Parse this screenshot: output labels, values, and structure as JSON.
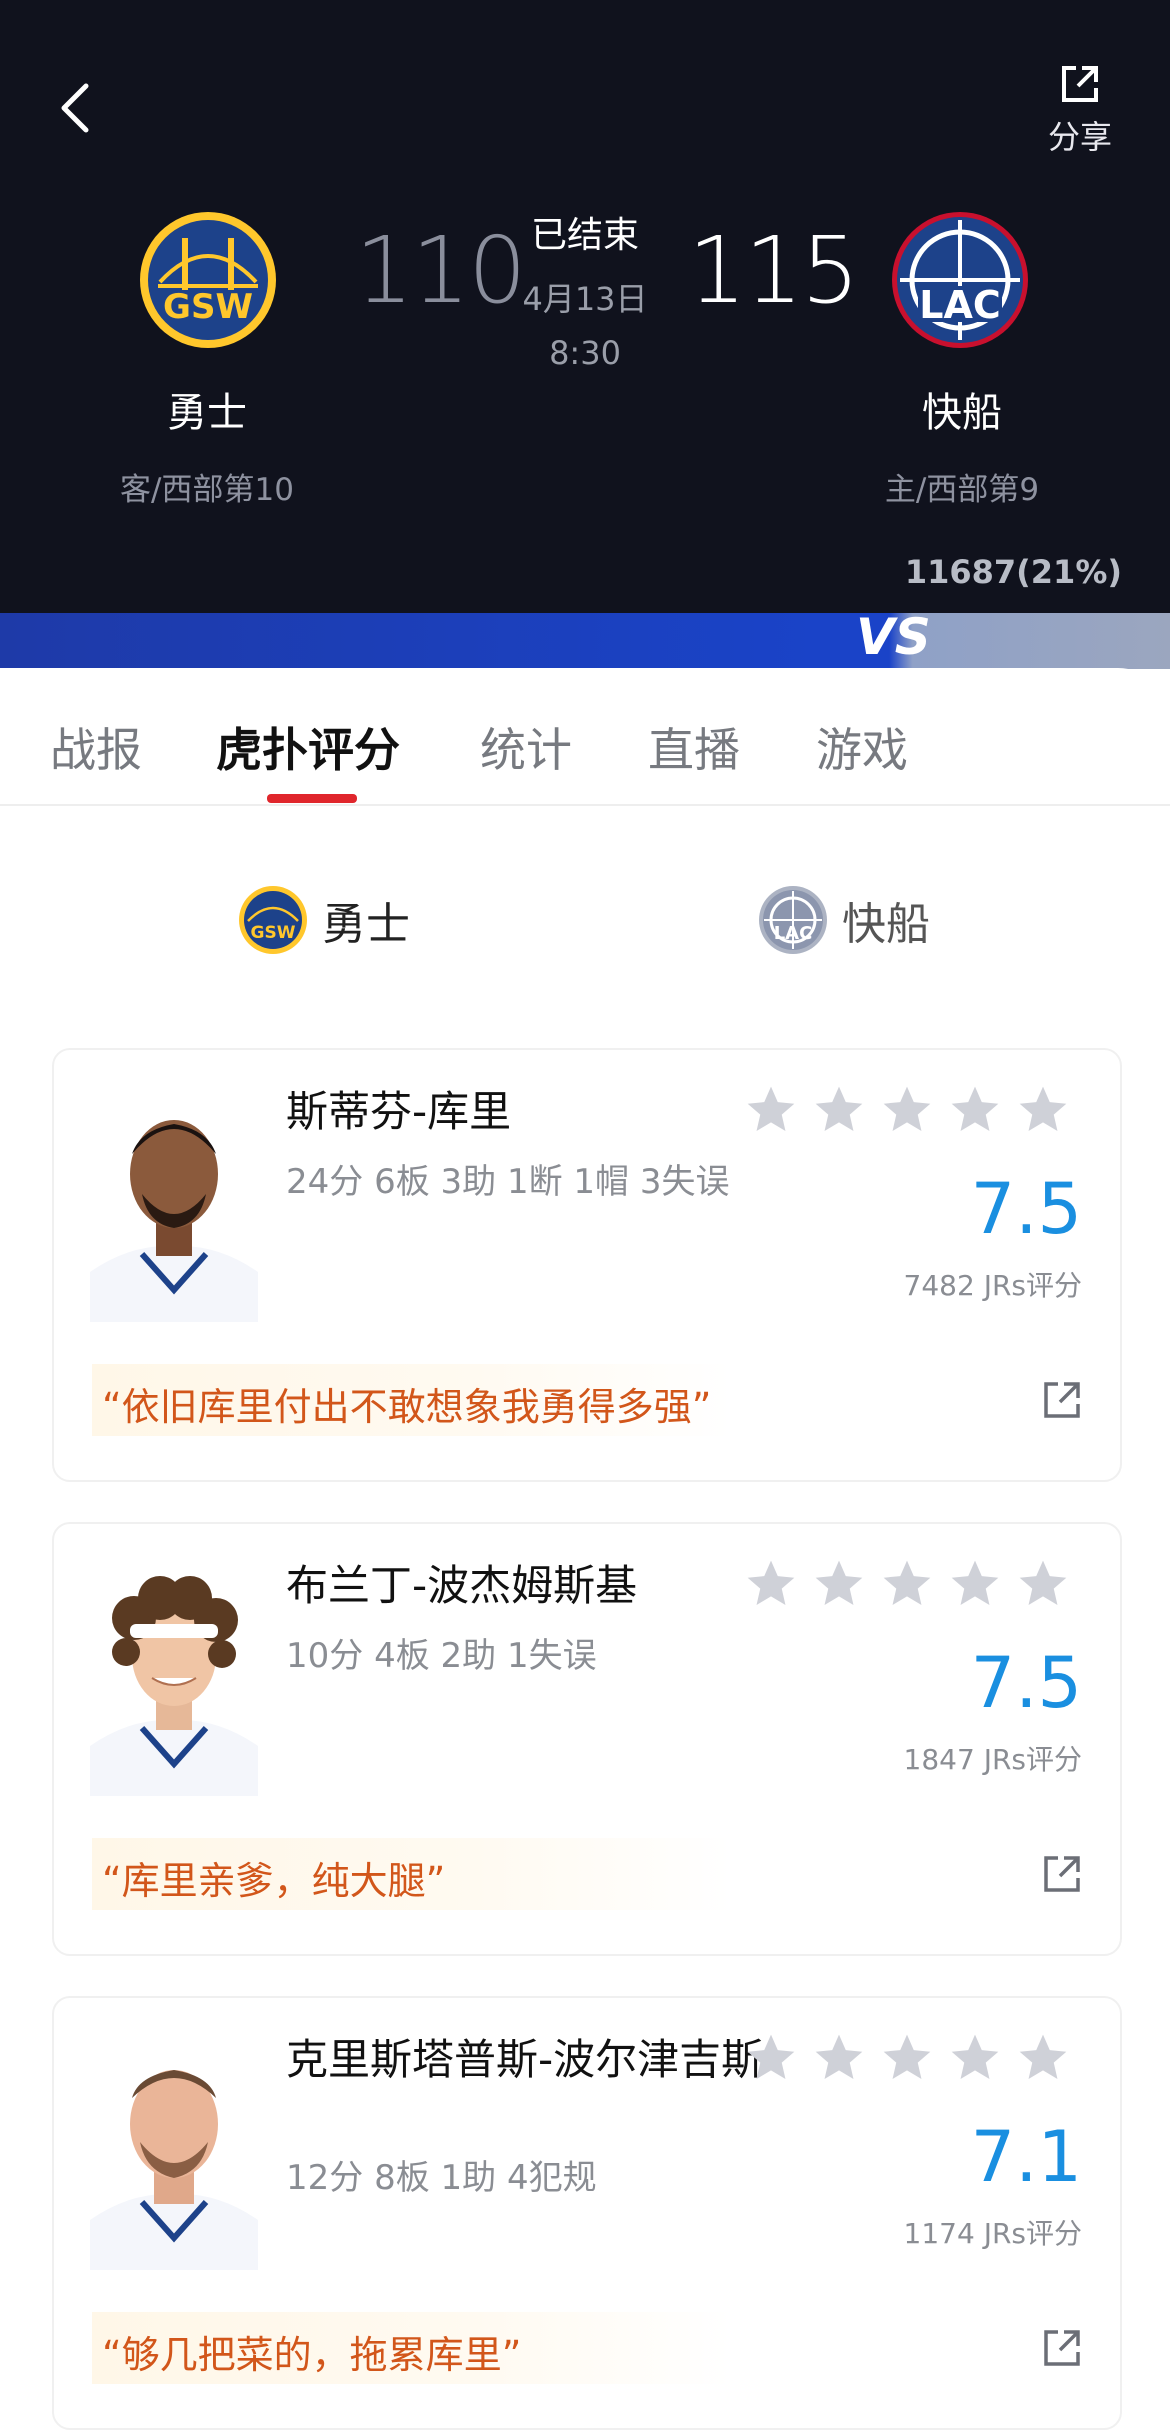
{
  "header": {
    "share_label": "分享",
    "status": "已结束",
    "date": "4月13日",
    "time": "8:30",
    "away": {
      "name": "勇士",
      "sub": "客/西部第10",
      "score": "110",
      "logo_text": "GSW"
    },
    "home": {
      "name": "快船",
      "sub": "主/西部第9",
      "score": "115",
      "logo_text": "LAC"
    },
    "blurred_text": "11687(21%)",
    "votes": "11687(21%)",
    "vs_label": "VS"
  },
  "tabs": [
    {
      "label": "战报"
    },
    {
      "label": "虎扑评分"
    },
    {
      "label": "统计"
    },
    {
      "label": "直播"
    },
    {
      "label": "游戏"
    }
  ],
  "team_toggle": {
    "away_label": "勇士",
    "home_label": "快船"
  },
  "players": [
    {
      "name": "斯蒂芬-库里",
      "stats": "24分 6板 3助 1断 1帽 3失误",
      "rating": "7.5",
      "jrs": "7482 JRs评分",
      "comment": "“依旧库里付出不敢想象我勇得多强”"
    },
    {
      "name": "布兰丁-波杰姆斯基",
      "stats": "10分 4板 2助 1失误",
      "rating": "7.5",
      "jrs": "1847 JRs评分",
      "comment": "“库里亲爹，纯大腿”"
    },
    {
      "name": "克里斯塔普斯-波尔津吉斯",
      "stats": "12分 8板 1助 4犯规",
      "rating": "7.1",
      "jrs": "1174 JRs评分",
      "comment": "“够几把菜的，拖累库里”"
    }
  ],
  "colors": {
    "header_bg": "#10121d",
    "accent_red": "#e0262c",
    "rating_blue": "#1a8fe0",
    "comment_orange": "#d2561a",
    "gsw_blue": "#1d428a",
    "gsw_gold": "#ffc72c"
  }
}
